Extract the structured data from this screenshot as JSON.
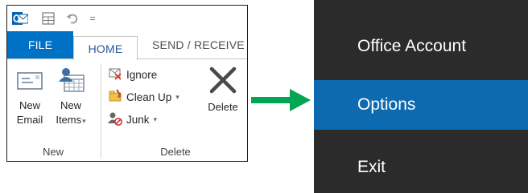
{
  "ribbon": {
    "quick_access": {
      "app_icon": "outlook-icon",
      "save_icon": "send-receive-folders-icon",
      "undo_icon": "undo-icon",
      "more_glyph": "="
    },
    "tabs": [
      {
        "label": "FILE",
        "active": false
      },
      {
        "label": "HOME",
        "active": true
      },
      {
        "label": "SEND / RECEIVE",
        "active": false
      }
    ],
    "groups": {
      "new": {
        "label": "New",
        "buttons": [
          {
            "line1": "New",
            "line2": "Email",
            "icon": "envelope-icon"
          },
          {
            "line1": "New",
            "line2": "Items",
            "icon": "new-items-icon",
            "has_dropdown": true
          }
        ]
      },
      "delete": {
        "label": "Delete",
        "buttons": [
          {
            "label": "Ignore",
            "icon": "ignore-icon"
          },
          {
            "label": "Clean Up",
            "icon": "clean-up-icon",
            "has_dropdown": true
          },
          {
            "label": "Junk",
            "icon": "junk-icon",
            "has_dropdown": true
          },
          {
            "label": "Delete",
            "icon": "delete-x-icon"
          }
        ]
      }
    },
    "colors": {
      "file_tab": "#0072c6",
      "home_tab_text": "#2b579a"
    }
  },
  "arrow": {
    "color": "#00a651",
    "icon": "right-arrow-icon"
  },
  "backstage": {
    "items": [
      {
        "label": "Office Account",
        "selected": false
      },
      {
        "label": "Options",
        "selected": true
      },
      {
        "label": "Exit",
        "selected": false
      }
    ],
    "colors": {
      "background": "#2b2b2b",
      "selected": "#0e6ab0",
      "text": "#ffffff"
    }
  }
}
